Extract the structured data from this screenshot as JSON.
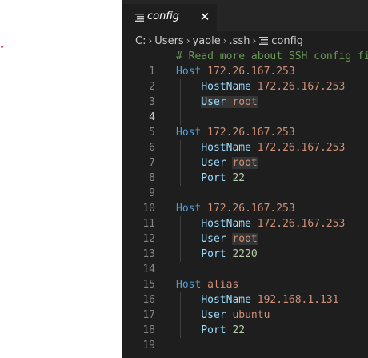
{
  "tab": {
    "label": "config",
    "close_glyph": "✕",
    "icon": "list-icon"
  },
  "breadcrumb": {
    "drive": "C:",
    "seg1": "Users",
    "seg2": "yaole",
    "seg3": ".ssh",
    "file": "config",
    "sep": "›"
  },
  "editor": {
    "active_line": 4,
    "line_numbers": [
      "1",
      "2",
      "3",
      "4",
      "5",
      "6",
      "7",
      "8",
      "9",
      "10",
      "11",
      "12",
      "13",
      "14",
      "15",
      "16",
      "17",
      "18",
      "19"
    ],
    "comment": "# Read more about SSH config fi",
    "hosts": [
      {
        "host_kw": "Host",
        "host_val": "172.26.167.253",
        "hostname_key": "HostName",
        "hostname_val": "172.26.167.253",
        "user_key": "User",
        "user_val": "root"
      },
      {
        "host_kw": "Host",
        "host_val": "172.26.167.253",
        "hostname_key": "HostName",
        "hostname_val": "172.26.167.253",
        "user_key": "User",
        "user_val": "root",
        "port_key": "Port",
        "port_val": "22"
      },
      {
        "host_kw": "Host",
        "host_val": "172.26.167.253",
        "hostname_key": "HostName",
        "hostname_val": "172.26.167.253",
        "user_key": "User",
        "user_val": "root",
        "port_key": "Port",
        "port_val": "2220"
      },
      {
        "host_kw": "Host",
        "host_val": "alias",
        "hostname_key": "HostName",
        "hostname_val": "192.168.1.131",
        "user_key": "User",
        "user_val": "ubuntu",
        "port_key": "Port",
        "port_val": "22"
      }
    ]
  },
  "colors": {
    "background": "#1e1e1e",
    "keyword": "#569cd6",
    "key": "#9cdcfe",
    "string": "#ce9178",
    "comment": "#6a9955",
    "number": "#b5cea8"
  }
}
